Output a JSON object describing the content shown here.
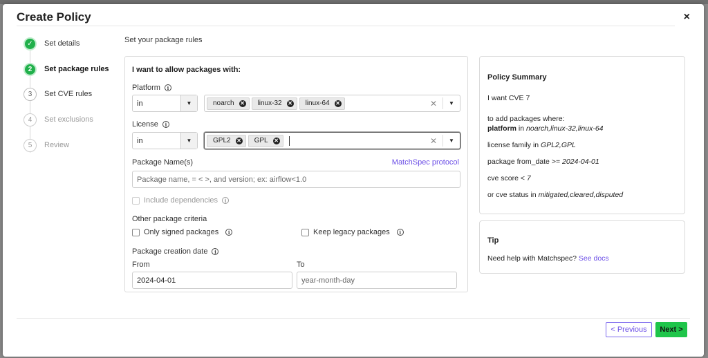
{
  "modal": {
    "title": "Create Policy",
    "close": "×"
  },
  "steps": [
    {
      "num": "✓",
      "label": "Set details",
      "state": "done"
    },
    {
      "num": "2",
      "label": "Set package rules",
      "state": "active"
    },
    {
      "num": "3",
      "label": "Set CVE rules",
      "state": "todo"
    },
    {
      "num": "4",
      "label": "Set exclusions",
      "state": "muted"
    },
    {
      "num": "5",
      "label": "Review",
      "state": "muted"
    }
  ],
  "section_heading": "Set your package rules",
  "rules": {
    "heading": "I want to allow packages with:",
    "platform": {
      "label": "Platform",
      "operator": "in",
      "chips": [
        "noarch",
        "linux-32",
        "linux-64"
      ]
    },
    "license": {
      "label": "License",
      "operator": "in",
      "chips": [
        "GPL2",
        "GPL"
      ]
    },
    "package_names": {
      "label": "Package Name(s)",
      "link": "MatchSpec protocol",
      "placeholder": "Package name, = < >, and version; ex: airflow<1.0"
    },
    "include_deps": "Include dependencies",
    "other_criteria": "Other package criteria",
    "only_signed": "Only signed packages",
    "keep_legacy": "Keep legacy packages",
    "creation_date": "Package creation date",
    "from_label": "From",
    "from_value": "2024-04-01",
    "to_label": "To",
    "to_placeholder": "year-month-day"
  },
  "summary": {
    "heading": "Policy Summary",
    "line1": "I want CVE 7",
    "line2": "to add packages where:",
    "platform_key": "platform",
    "platform_in": " in ",
    "platform_val": "noarch,linux-32,linux-64",
    "license_key": "license family",
    "license_in": " in ",
    "license_val": "GPL2,GPL",
    "from_key": "package from_date",
    "from_op": " >= ",
    "from_val": "2024-04-01",
    "score_key": "cve score",
    "score_op": " < ",
    "score_val": "7",
    "status_prefix": "or ",
    "status_key": "cve status",
    "status_in": " in ",
    "status_val": "mitigated,cleared,disputed"
  },
  "tip": {
    "heading": "Tip",
    "text": "Need help with Matchspec?",
    "link": "See docs"
  },
  "footer": {
    "previous": "< Previous",
    "next": "Next >"
  }
}
